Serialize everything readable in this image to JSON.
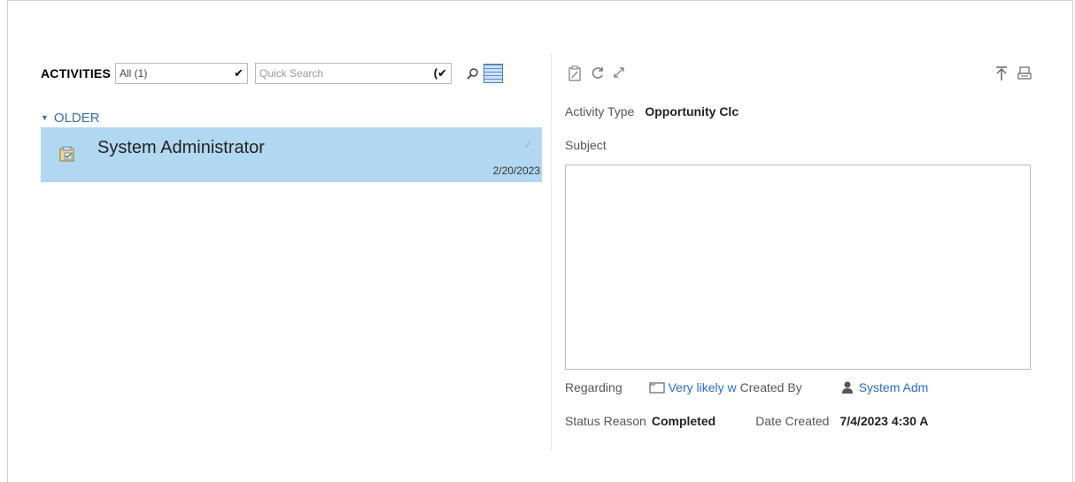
{
  "activities": {
    "title": "ACTIVITIES",
    "view_selected": "All (1)",
    "search_placeholder": "Quick Search",
    "group": {
      "label": "OLDER",
      "items": [
        {
          "name": "System Administrator",
          "date": "2/20/2023"
        }
      ]
    }
  },
  "detail": {
    "activity_type_label": "Activity Type",
    "activity_type_value": "Opportunity Clc",
    "subject_label": "Subject",
    "regarding_label": "Regarding",
    "regarding_value": "Very likely w",
    "created_by_label": "Created By",
    "created_by_value": "System Adm",
    "status_reason_label": "Status Reason",
    "status_reason_value": "Completed",
    "date_created_label": "Date Created",
    "date_created_value": "7/4/2023 4:30 A"
  },
  "icons": [
    "chevron-down-icon",
    "search-icon",
    "calendar-icon",
    "task-icon",
    "checkmark-icon",
    "edit-icon",
    "refresh-icon",
    "expand-icon",
    "pin-icon",
    "print-icon",
    "record-icon",
    "user-icon"
  ],
  "colors": {
    "selected_row": "#b2d7f0",
    "link": "#2a6ebb",
    "group_header": "#3b6ea5"
  }
}
